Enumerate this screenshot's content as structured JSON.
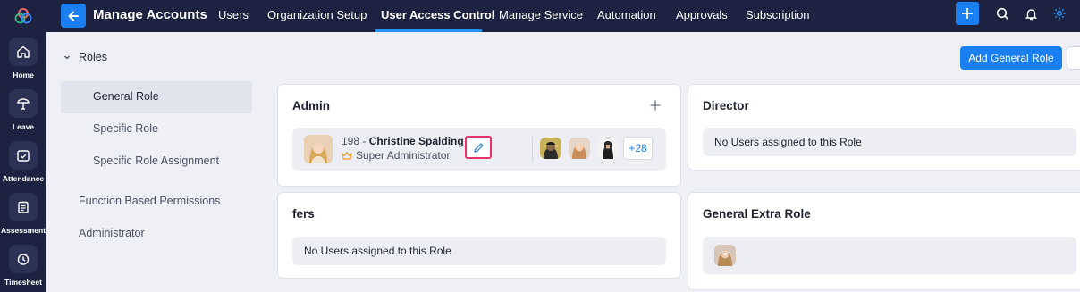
{
  "rail": {
    "items": [
      {
        "label": "Home",
        "icon": "home-icon"
      },
      {
        "label": "Leave",
        "icon": "leave-icon"
      },
      {
        "label": "Attendance",
        "icon": "attendance-icon"
      },
      {
        "label": "Assessment",
        "icon": "assessment-icon"
      },
      {
        "label": "Timesheet",
        "icon": "timesheet-icon"
      }
    ]
  },
  "header": {
    "title": "Manage Accounts",
    "tabs": [
      "Users",
      "Organization Setup",
      "User Access Control",
      "Manage Service",
      "Automation",
      "Approvals",
      "Subscription"
    ],
    "active_tab": "User Access Control"
  },
  "sidebar": {
    "section": "Roles",
    "items": [
      "General Role",
      "Specific Role",
      "Specific Role Assignment"
    ],
    "other": [
      "Function Based Permissions",
      "Administrator"
    ]
  },
  "actions": {
    "add_role": "Add General Role"
  },
  "cards": [
    {
      "title": "Admin",
      "user_id": "198",
      "user_sep": " - ",
      "user_name": "Christine Spalding",
      "user_role": "Super Administrator",
      "more_count": "+28"
    },
    {
      "title": "Director",
      "empty": "No Users assigned to this Role"
    },
    {
      "title": "fers",
      "empty": "No Users assigned to this Role"
    },
    {
      "title": "General Extra Role"
    }
  ],
  "colors": {
    "navy": "#1d2240",
    "accent": "#1a7ff0",
    "highlight": "#e8336a"
  }
}
